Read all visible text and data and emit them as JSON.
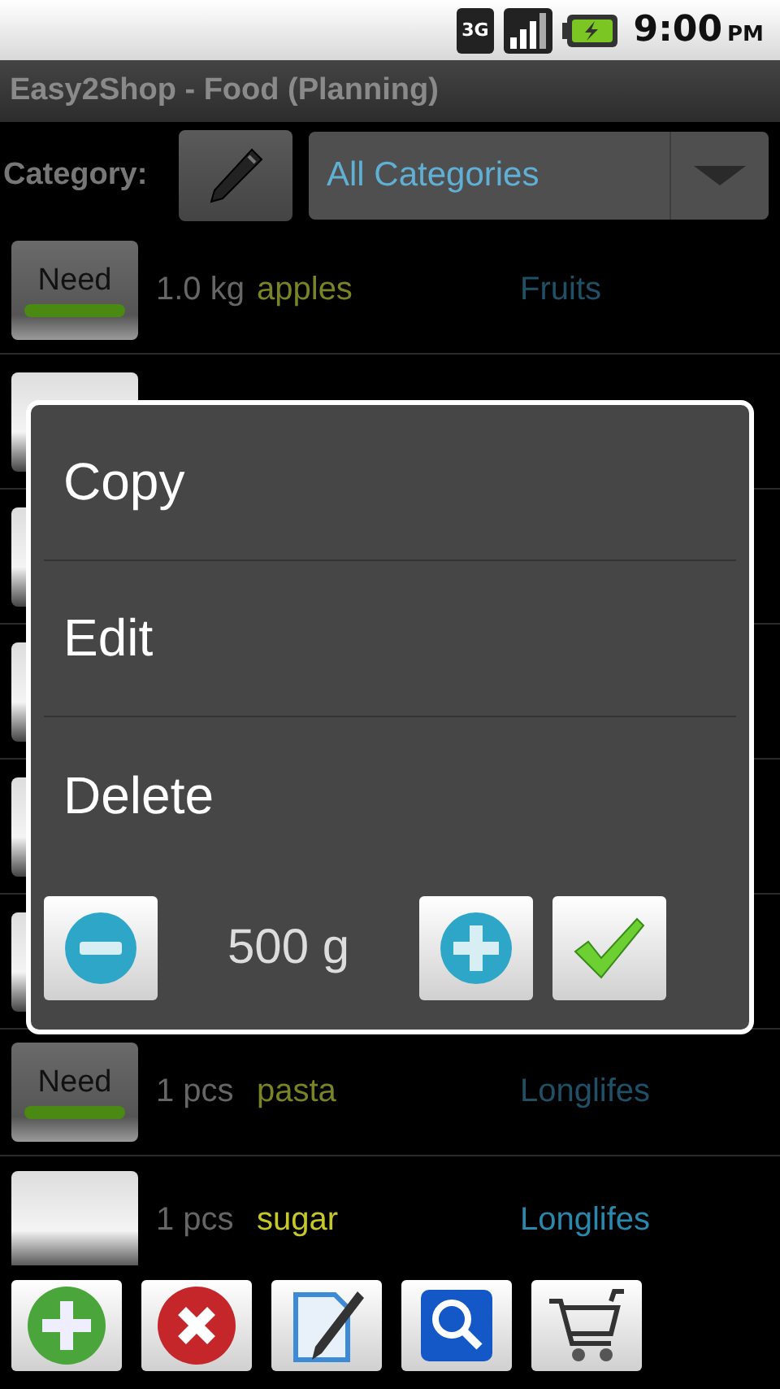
{
  "status_bar": {
    "network": "3G",
    "time": "9:00",
    "ampm": "PM"
  },
  "title_bar": {
    "title": "Easy2Shop - Food (Planning)"
  },
  "category": {
    "label": "Category:",
    "value": "All Categories"
  },
  "rows": [
    {
      "kind": "item",
      "need": true,
      "toggle_label": "Need",
      "quantity": "1.0 kg",
      "name": "apples",
      "category": "Fruits"
    },
    {
      "kind": "covered",
      "need": false
    },
    {
      "kind": "covered",
      "need": false
    },
    {
      "kind": "covered",
      "need": false
    },
    {
      "kind": "covered",
      "need": false
    },
    {
      "kind": "covered",
      "need": false
    },
    {
      "kind": "item",
      "need": true,
      "toggle_label": "Need",
      "quantity": "1 pcs",
      "name": "pasta",
      "category": "Longlifes"
    },
    {
      "kind": "item",
      "need": false,
      "quantity": "1 pcs",
      "name": "sugar",
      "category": "Longlifes"
    }
  ],
  "context_menu": {
    "items": [
      "Copy",
      "Edit",
      "Delete"
    ],
    "amount": "500 g"
  }
}
